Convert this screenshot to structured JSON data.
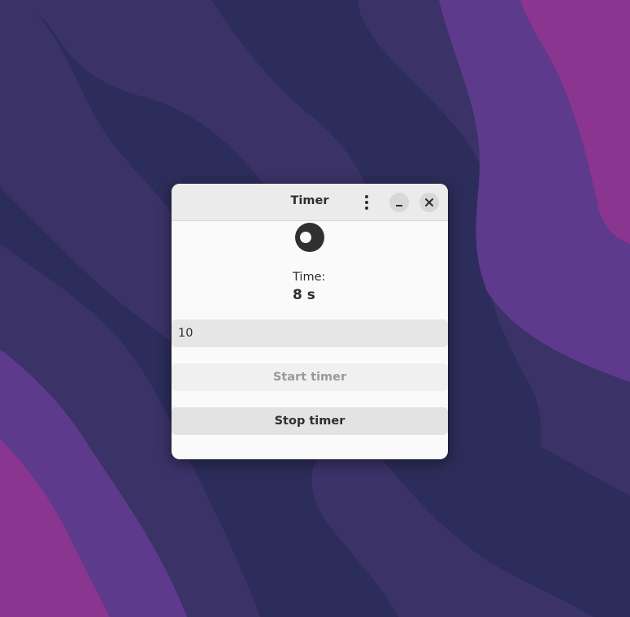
{
  "window": {
    "title": "Timer"
  },
  "icons": {
    "menu": "vertical-dots-icon",
    "minimize": "minimize-icon",
    "close": "close-icon",
    "status": "spinner-icon"
  },
  "timer": {
    "label": "Time:",
    "value": "8 s"
  },
  "duration_input": {
    "value": "10"
  },
  "buttons": {
    "start_label": "Start timer",
    "start_enabled": false,
    "stop_label": "Stop timer"
  },
  "colors": {
    "wallpaper_dark": "#2c2d5a",
    "wallpaper_mid": "#3b3268",
    "wallpaper_purple": "#5e3a8c",
    "wallpaper_magenta": "#8a3590"
  }
}
